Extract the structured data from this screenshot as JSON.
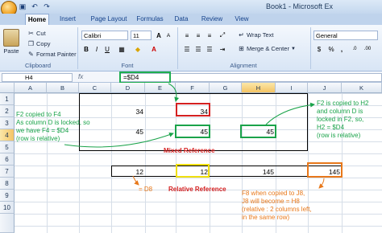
{
  "window": {
    "title": "Book1 - Microsoft Ex"
  },
  "tabs": [
    "Home",
    "Insert",
    "Page Layout",
    "Formulas",
    "Data",
    "Review",
    "View"
  ],
  "clipboard": {
    "cut": "Cut",
    "copy": "Copy",
    "paste": "Paste",
    "format_painter": "Format Painter",
    "label": "Clipboard"
  },
  "font": {
    "name": "Calibri",
    "size": "11",
    "label": "Font",
    "bold": "B",
    "italic": "I",
    "underline": "U",
    "grow": "A",
    "shrink": "A"
  },
  "alignment": {
    "wrap": "Wrap Text",
    "merge": "Merge & Center",
    "label": "Alignment"
  },
  "number": {
    "format": "General",
    "currency": "$",
    "percent": "%",
    "comma": ","
  },
  "formula_bar": {
    "name_box": "H4",
    "fx": "fx",
    "formula": "=$D4"
  },
  "columns": [
    "A",
    "B",
    "C",
    "D",
    "E",
    "F",
    "G",
    "H",
    "I",
    "J",
    "K"
  ],
  "rows": [
    "1",
    "2",
    "3",
    "4",
    "5",
    "6",
    "7",
    "8",
    "9",
    "10"
  ],
  "cells": {
    "d2": "34",
    "f2": "34",
    "d4": "45",
    "f4": "45",
    "h4": "45",
    "d8": "12",
    "f8": "12",
    "h8": "145",
    "j8": "145"
  },
  "annotations": {
    "left_note": [
      "F2 copied to F4",
      "As column D is locked, so",
      "we have F4 = $D4",
      "(row is relative)"
    ],
    "right_note": [
      "F2 is copied to H2",
      "and column D is",
      "locked in F2, so,",
      "H2 = $D4",
      "(row is relative)"
    ],
    "mixed_reference": "Mixed Reference",
    "d8_label": "= D8",
    "relative_reference": "Relative Reference",
    "bottom_note": [
      "F8 when copied to J8,",
      "J8 will become = H8",
      "(relative : 2 columns left,",
      "in the same row)"
    ]
  }
}
